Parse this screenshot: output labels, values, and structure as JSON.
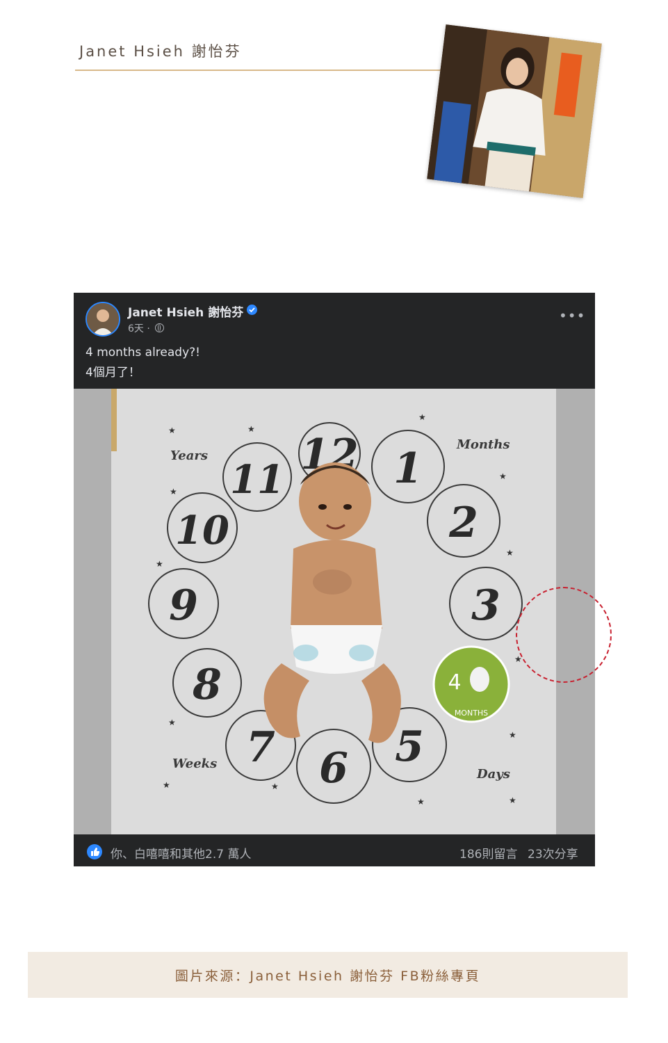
{
  "article": {
    "author_label": "Janet Hsieh 謝怡芬",
    "caption": "圖片來源：Janet Hsieh 謝怡芬 FB粉絲專頁",
    "accent_color": "#d8b98a"
  },
  "facebook_post": {
    "page_name": "Janet Hsieh 謝怡芬",
    "verified": true,
    "timestamp": "6天 ·",
    "text_line_1": "4 months already?!",
    "text_line_2": "4個月了！",
    "more_icon": "•••",
    "photo": {
      "blanket_labels": {
        "years": "Years",
        "months": "Months",
        "weeks": "Weeks",
        "days": "Days",
        "sticker_number": "4",
        "sticker_label": "MONTHS"
      },
      "clock_numbers": [
        "12",
        "1",
        "2",
        "3",
        "5",
        "6",
        "7",
        "8",
        "9",
        "10",
        "11"
      ]
    },
    "reactions_text": "你、白嘻嘻和其他2.7 萬人",
    "comments_text": "186則留言",
    "shares_text": "23次分享",
    "brand_color": "#2d88ff"
  }
}
